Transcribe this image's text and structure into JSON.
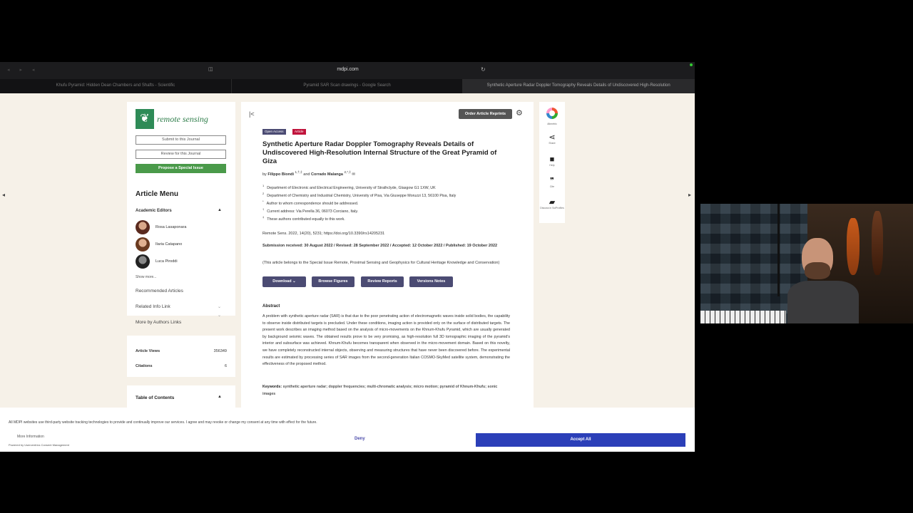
{
  "browser": {
    "url": "mdpi.com",
    "tabs": [
      "Khufu Pyramid: Hidden Dean Chambers and Shafts - Scientific",
      "Pyramid SAR Scan drawings - Google Search",
      "Synthetic Aperture Radar Doppler Tomography Reveals Details of Undiscovered High-Resolution"
    ]
  },
  "sidebar": {
    "journal_name": "remote sensing",
    "submit_label": "Submit to this Journal",
    "review_label": "Review for this Journal",
    "propose_label": "Propose a Special Issue",
    "menu_title": "Article Menu",
    "academic_editors_label": "Academic Editors",
    "editors": [
      "Rosa Lasaponara",
      "Ilaria Catapano",
      "Luca Piroddi"
    ],
    "show_more": "Show more...",
    "links": [
      "Recommended Articles",
      "Related Info Link",
      "More by Authors Links"
    ],
    "stats": {
      "views_label": "Article Views",
      "views_value": "356349",
      "citations_label": "Citations",
      "citations_value": "6"
    },
    "toc_label": "Table of Contents"
  },
  "article": {
    "order_reprints": "Order Article Reprints",
    "badge_open": "Open Access",
    "badge_type": "Article",
    "title": "Synthetic Aperture Radar Doppler Tomography Reveals Details of Undiscovered High-Resolution Internal Structure of the Great Pyramid of Giza",
    "authors_prefix": "by",
    "author1": "Filippo Biondi",
    "author1_sup": "1,†,‡",
    "authors_and": "and",
    "author2": "Corrado Malanga",
    "author2_sup": "2,*,‡",
    "affiliations": [
      {
        "mark": "1",
        "text": "Department of Electronic and Electrical Engineering, University of Strathclyde, Glasgow G1 1XW, UK"
      },
      {
        "mark": "2",
        "text": "Department of Chemistry and Industrial Chemistry, University of Pisa, Via Giuseppe Moruzzi 13, 56100 Pisa, Italy"
      },
      {
        "mark": "*",
        "text": "Author to whom correspondence should be addressed."
      },
      {
        "mark": "†",
        "text": "Current address: Via Perella 36, 06073 Corciano, Italy."
      },
      {
        "mark": "‡",
        "text": "These authors contributed equally to this work."
      }
    ],
    "citation": "Remote Sens. 2022, 14(20), 5231; https://doi.org/10.3390/rs14205231",
    "dates": "Submission received: 30 August 2022 / Revised: 28 September 2022 / Accepted: 12 October 2022 / Published: 19 October 2022",
    "special_issue": "(This article belongs to the Special Issue Remote, Proximal Sensing and Geophysics for Cultural Heritage Knowledge and Conservation)",
    "buttons": [
      "Download",
      "Browse Figures",
      "Review Reports",
      "Versions Notes"
    ],
    "abstract_title": "Abstract",
    "abstract": "A problem with synthetic aperture radar (SAR) is that due to the poor penetrating action of electromagnetic waves inside solid bodies, the capability to observe inside distributed targets is precluded. Under these conditions, imaging action is provided only on the surface of distributed targets. The present work describes an imaging method based on the analysis of micro-movements on the Khnum-Khufu Pyramid, which are usually generated by background seismic waves. The obtained results prove to be very promising, as high-resolution full 3D tomographic imaging of the pyramid's interior and subsurface was achieved. Khnum-Khufu becomes transparent when observed in the micro-movement domain. Based on this novelty, we have completely reconstructed internal objects, observing and measuring structures that have never been discovered before. The experimental results are estimated by processing series of SAR images from the second-generation Italian COSMO-SkyMed satellite system, demonstrating the effectiveness of the proposed method.",
    "keywords_label": "Keywords:",
    "keywords": "synthetic aperture radar; doppler frequencies; multi-chromatic analysis; micro motion; pyramid of Khnum-Khufu; sonic images"
  },
  "right_tools": [
    "Altmetric",
    "Share",
    "Help",
    "Cite",
    "Discuss in SciProfiles"
  ],
  "cookie": {
    "text": "All MDPI websites use third-party website tracking technologies to provide and continually improve our services. I agree and may revoke or change my consent at any time with effect for the future.",
    "more_info": "More Information",
    "powered": "Powered by Usercentrics Consent Management",
    "deny": "Deny",
    "accept": "Accept All"
  }
}
